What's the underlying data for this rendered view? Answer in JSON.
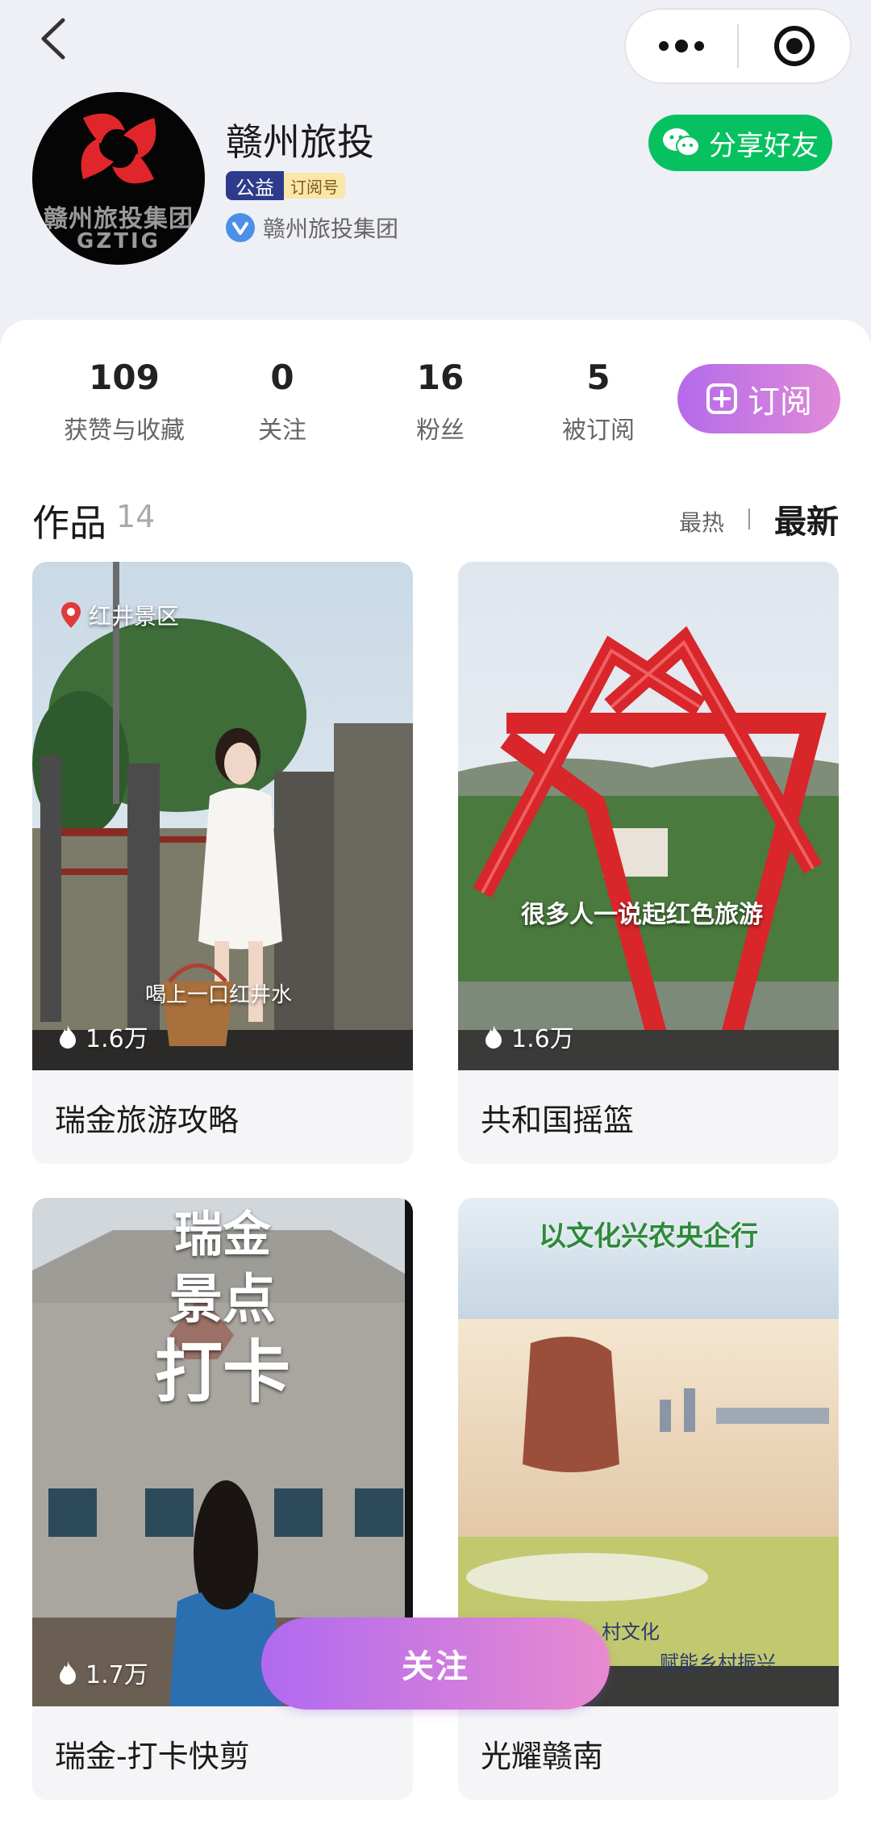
{
  "header": {
    "account_name": "赣州旅投",
    "tag_public": "公益",
    "tag_subscription": "订阅号",
    "verified_entity": "赣州旅投集团",
    "share_label": "分享好友",
    "avatar_text": "赣州旅投集团",
    "avatar_sub": "GZTIG"
  },
  "stats": [
    {
      "value": "109",
      "label": "获赞与收藏"
    },
    {
      "value": "0",
      "label": "关注"
    },
    {
      "value": "16",
      "label": "粉丝"
    },
    {
      "value": "5",
      "label": "被订阅"
    }
  ],
  "subscribe_label": "订阅",
  "works": {
    "title": "作品",
    "count": "14",
    "sort_hot": "最热",
    "sort_new": "最新"
  },
  "cards": [
    {
      "title": "瑞金旅游攻略",
      "likes": "1.6万",
      "location": "红井景区",
      "subtitle": "喝上一口红井水"
    },
    {
      "title": "共和国摇篮",
      "likes": "1.6万",
      "overlay": "很多人一说起红色旅游"
    },
    {
      "title": "瑞金-打卡快剪",
      "likes": "1.7万",
      "overlay_lines": [
        "瑞金",
        "景点",
        "打卡"
      ]
    },
    {
      "title": "光耀赣南",
      "likes": "",
      "overlay_top": "以文化兴农央企行",
      "overlay_bottom": "赋能乡村振兴",
      "overlay_mid": "村文化"
    }
  ],
  "follow_label": "关注",
  "colors": {
    "wechat_green": "#07c160",
    "accent_purple": "#b46bea",
    "accent_pink": "#e08ad8"
  }
}
